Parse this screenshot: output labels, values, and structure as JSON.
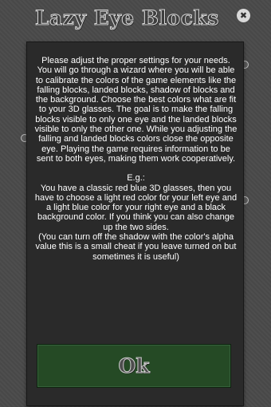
{
  "app": {
    "title": "Lazy Eye Blocks",
    "close_icon_glyph": "✖"
  },
  "dialog": {
    "paragraph_1": "Please adjust the proper settings for your needs. You will go through a wizard where you will be able to calibrate the colors of the game elements like the falling blocks, landed blocks, shadow of blocks and the background. Choose the best colors what are fit to your 3D glasses. The goal is to make the falling blocks visible to only one eye and the landed blocks visible to only the other one. While you adjusting the falling and landed blocks colors close the opposite eye. Playing the game requires information to be sent to both eyes, making them work cooperatively.",
    "example_heading": "E.g.:",
    "paragraph_2": "You have a classic red blue 3D glasses, then you have to choose a light red color for your left eye and a light blue color for your right eye and a black background color. If you think you can also change up the two sides.",
    "paragraph_3": "(You can turn off the shadow with the color's alpha value this is a small cheat if you leave turned on but sometimes it is useful)",
    "ok_label": "Ok"
  },
  "colors": {
    "background": "#4a4a4a",
    "dialog_background": "#2a2a2a",
    "ok_button": "#254a25",
    "text": "#ffffff"
  }
}
